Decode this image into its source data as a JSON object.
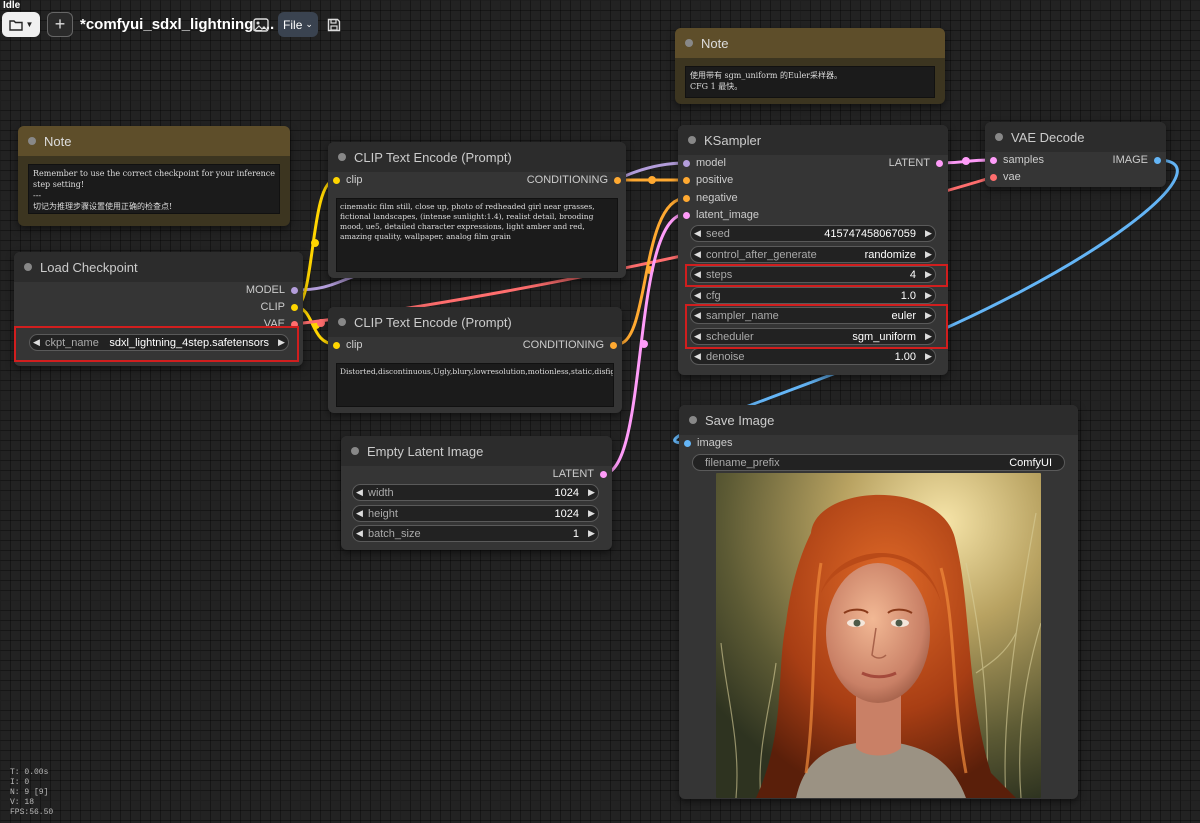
{
  "status": "Idle",
  "toolbar": {
    "folder_icon": "folder-icon",
    "new_tab_label": "+",
    "workflow_title": "*comfyui_sdxl_lightning_...",
    "file_label": "File"
  },
  "stats": {
    "t": "T: 0.00s",
    "i": "I: 0",
    "n": "N: 9 [9]",
    "v": "V: 18",
    "fps": "FPS:56.50"
  },
  "colors": {
    "model": "#b39ddb",
    "clip": "#ffd500",
    "vae": "#ff6e6e",
    "conditioning": "#ffa931",
    "latent": "#ff9cf9",
    "image": "#64b5f6",
    "highlight": "#d11e1e",
    "note_header": "#5e4e2a"
  },
  "notes": {
    "note1": {
      "title": "Note",
      "text": "Remember to use the correct checkpoint for your inference step setting!\n---\n切记为推理步骤设置使用正确的检查点!"
    },
    "note2": {
      "title": "Note",
      "text": "使用带有 sgm_uniform 的Euler采样器。\nCFG 1 最快。"
    }
  },
  "load_checkpoint": {
    "title": "Load Checkpoint",
    "outputs": [
      "MODEL",
      "CLIP",
      "VAE"
    ],
    "ckpt_name": {
      "label": "ckpt_name",
      "value": "sdxl_lightning_4step.safetensors"
    }
  },
  "clip_pos": {
    "title": "CLIP Text Encode (Prompt)",
    "input": "clip",
    "output": "CONDITIONING",
    "text": "cinematic film still, close up, photo of redheaded girl near grasses, fictional landscapes, (intense sunlight:1.4), realist detail, brooding mood, ue5, detailed character expressions, light amber and red, amazing quality, wallpaper, analog film grain"
  },
  "clip_neg": {
    "title": "CLIP Text Encode (Prompt)",
    "input": "clip",
    "output": "CONDITIONING",
    "text": "Distorted,discontinuous,Ugly,blury,lowresolution,motionless,static,disfigured,disconnectedlimbs,Ugyfaces,incompletearms,watermark"
  },
  "empty_latent": {
    "title": "Empty Latent Image",
    "output": "LATENT",
    "widgets": [
      {
        "label": "width",
        "value": "1024"
      },
      {
        "label": "height",
        "value": "1024"
      },
      {
        "label": "batch_size",
        "value": "1"
      }
    ]
  },
  "ksampler": {
    "title": "KSampler",
    "inputs": [
      "model",
      "positive",
      "negative",
      "latent_image"
    ],
    "output": "LATENT",
    "widgets": [
      {
        "label": "seed",
        "value": "415747458067059"
      },
      {
        "label": "control_after_generate",
        "value": "randomize"
      },
      {
        "label": "steps",
        "value": "4"
      },
      {
        "label": "cfg",
        "value": "1.0"
      },
      {
        "label": "sampler_name",
        "value": "euler"
      },
      {
        "label": "scheduler",
        "value": "sgm_uniform"
      },
      {
        "label": "denoise",
        "value": "1.00"
      }
    ]
  },
  "vae_decode": {
    "title": "VAE Decode",
    "inputs": [
      "samples",
      "vae"
    ],
    "output": "IMAGE"
  },
  "save_image": {
    "title": "Save Image",
    "input": "images",
    "filename_prefix": {
      "label": "filename_prefix",
      "value": "ComfyUI"
    },
    "preview": "portrait of a red-haired woman in sunlit tall grass"
  }
}
